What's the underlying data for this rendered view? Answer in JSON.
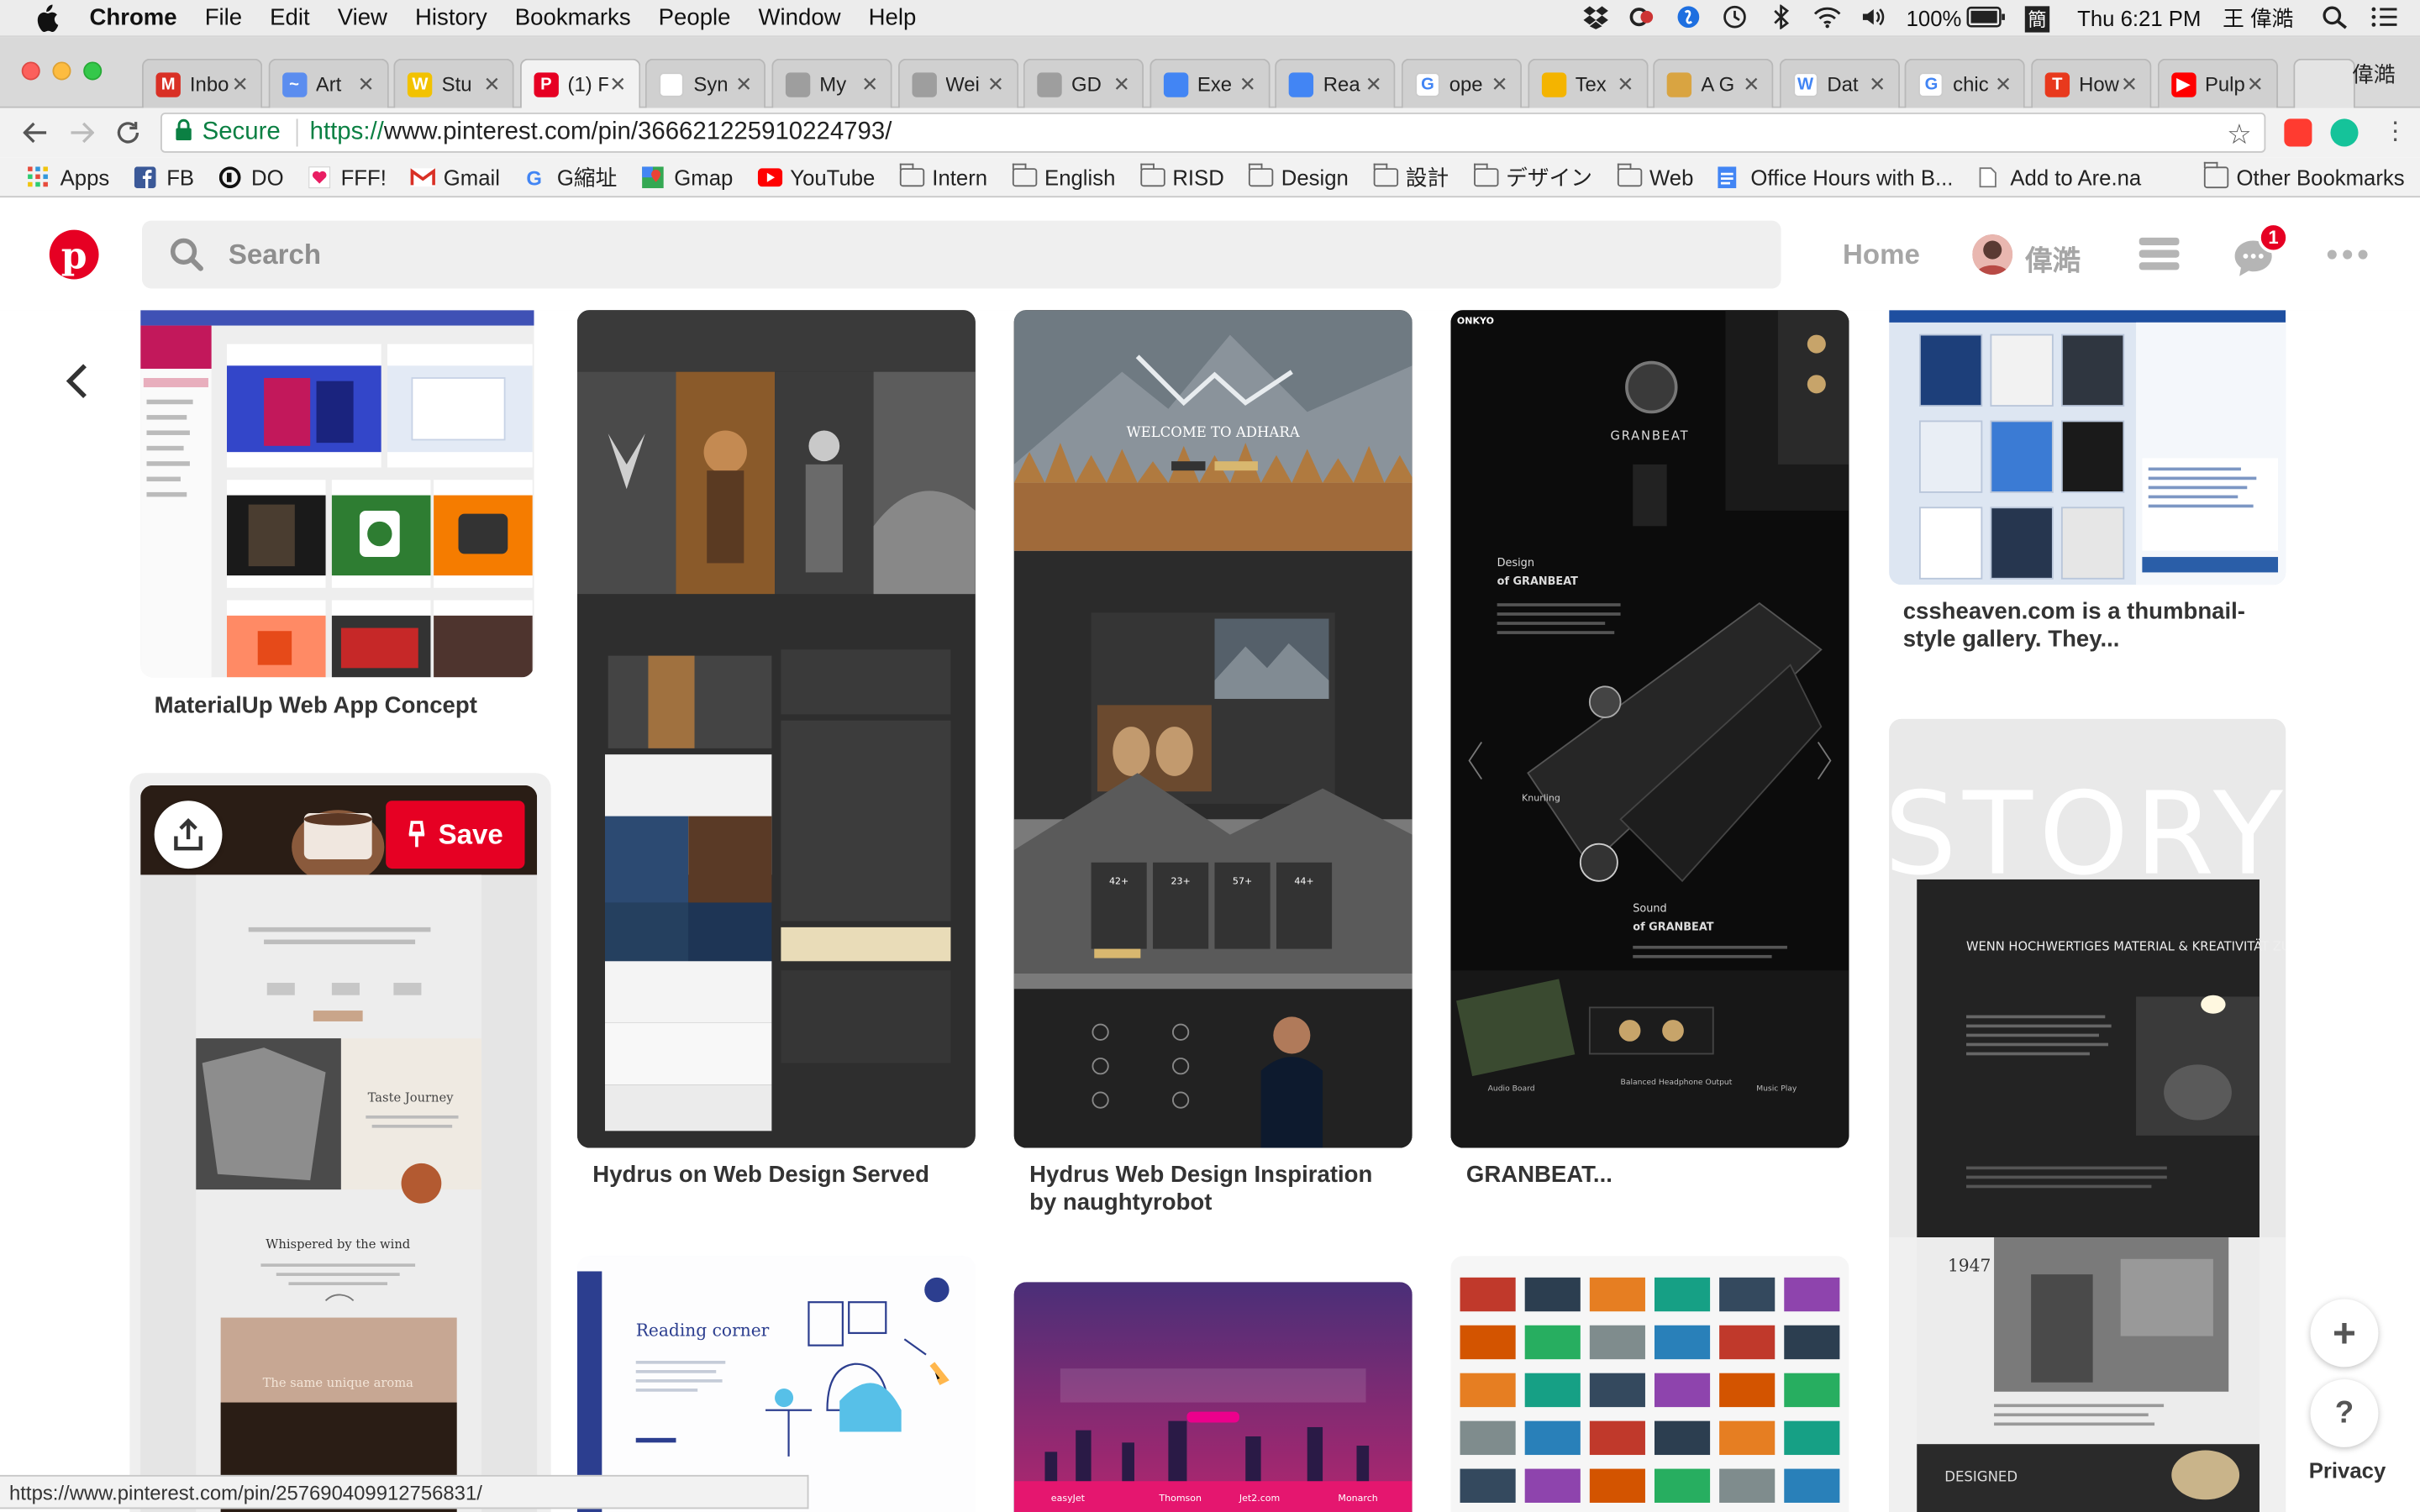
{
  "menubar": {
    "app": "Chrome",
    "items": [
      "File",
      "Edit",
      "View",
      "History",
      "Bookmarks",
      "People",
      "Window",
      "Help"
    ],
    "battery": "100%",
    "ime": "簡",
    "clock": "Thu 6:21 PM",
    "user": "王 偉澔"
  },
  "tabs": [
    {
      "label": "Inbo",
      "fav": "M",
      "color": "#d93025"
    },
    {
      "label": "Art",
      "fav": "~",
      "color": "#5b8def"
    },
    {
      "label": "Stu",
      "fav": "W",
      "color": "#f2c200"
    },
    {
      "label": "(1) F",
      "fav": "P",
      "color": "#e60023"
    },
    {
      "label": "Syn",
      "fav": "",
      "color": "#ffffff"
    },
    {
      "label": "My",
      "fav": "",
      "color": "#9e9e9e"
    },
    {
      "label": "Wei",
      "fav": "",
      "color": "#9e9e9e"
    },
    {
      "label": "GD",
      "fav": "",
      "color": "#9e9e9e"
    },
    {
      "label": "Exe",
      "fav": "",
      "color": "#4285f4"
    },
    {
      "label": "Rea",
      "fav": "",
      "color": "#4285f4"
    },
    {
      "label": "ope",
      "fav": "G",
      "color": "#ffffff"
    },
    {
      "label": "Tex",
      "fav": "",
      "color": "#f4b400"
    },
    {
      "label": "A G",
      "fav": "",
      "color": "#d9a441"
    },
    {
      "label": "Dat",
      "fav": "W",
      "color": "#ffffff"
    },
    {
      "label": "chic",
      "fav": "G",
      "color": "#ffffff"
    },
    {
      "label": "How",
      "fav": "T",
      "color": "#e8391d"
    },
    {
      "label": "Pulp",
      "fav": "▶",
      "color": "#ff0000"
    }
  ],
  "profile_name": "偉澔",
  "toolbar": {
    "secure": "Secure",
    "url_scheme": "https://",
    "url_rest": "www.pinterest.com/pin/366621225910224793/"
  },
  "bookmarks": [
    {
      "label": "Apps",
      "icon": "apps"
    },
    {
      "label": "FB",
      "icon": "fb"
    },
    {
      "label": "DO",
      "icon": "do"
    },
    {
      "label": "FFF!",
      "icon": "fff"
    },
    {
      "label": "Gmail",
      "icon": "gmail"
    },
    {
      "label": "G縮址",
      "icon": "google"
    },
    {
      "label": "Gmap",
      "icon": "gmap"
    },
    {
      "label": "YouTube",
      "icon": "youtube"
    },
    {
      "label": "Intern",
      "icon": "folder"
    },
    {
      "label": "English",
      "icon": "folder"
    },
    {
      "label": "RISD",
      "icon": "folder"
    },
    {
      "label": "Design",
      "icon": "folder"
    },
    {
      "label": "設計",
      "icon": "folder"
    },
    {
      "label": "デザイン",
      "icon": "folder"
    },
    {
      "label": "Web",
      "icon": "folder"
    },
    {
      "label": "Office Hours with B...",
      "icon": "doc"
    },
    {
      "label": "Add to Are.na",
      "icon": "page"
    }
  ],
  "other_bookmarks": "Other Bookmarks",
  "pinterest": {
    "search_placeholder": "Search",
    "home": "Home",
    "username": "偉澔",
    "notification_count": "1",
    "save": "Save",
    "privacy": "Privacy",
    "plus": "+",
    "help": "?"
  },
  "pins": {
    "p1": {
      "title": "MaterialUp Web App Concept"
    },
    "p2": {
      "title": "Hydrus on Web Design Served"
    },
    "p3": {
      "title": "Hydrus Web Design Inspiration by naughtyrobot",
      "heading": "WELCOME TO ADHARA"
    },
    "p4": {
      "title": "GRANBEAT...",
      "brand": "ONKYO",
      "logo": "GRANBEAT",
      "h1": "Design",
      "h1b": "of GRANBEAT",
      "h2": "Sound",
      "h2b": "of GRANBEAT",
      "knurling": "Knurling",
      "f1": "Audio Board",
      "f2": "Balanced Headphone Output",
      "f3": "Music Play"
    },
    "p5": {
      "title": "cssheaven.com is a thumbnail-style gallery. They..."
    },
    "p6": {
      "story": "STORY",
      "headline": "WENN HOCHWERTIGES MATERIAL & KREATIVITÄT ZUSAMMENFINDEN",
      "year": "1947",
      "footer": "DESIGNED"
    },
    "p7": {
      "t1": "Taste Journey",
      "t2": "Whispered by the wind",
      "t3": "The same unique aroma"
    },
    "p8": {
      "heading": "Reading corner"
    },
    "p9": {
      "brands": [
        "easyJet",
        "Thomson",
        "Jet2.com",
        "Monarch"
      ]
    },
    "p3b": {
      "cols": [
        "42+",
        "23+",
        "57+",
        "44+"
      ]
    }
  },
  "statusbar": "https://www.pinterest.com/pin/257690409912756831/"
}
